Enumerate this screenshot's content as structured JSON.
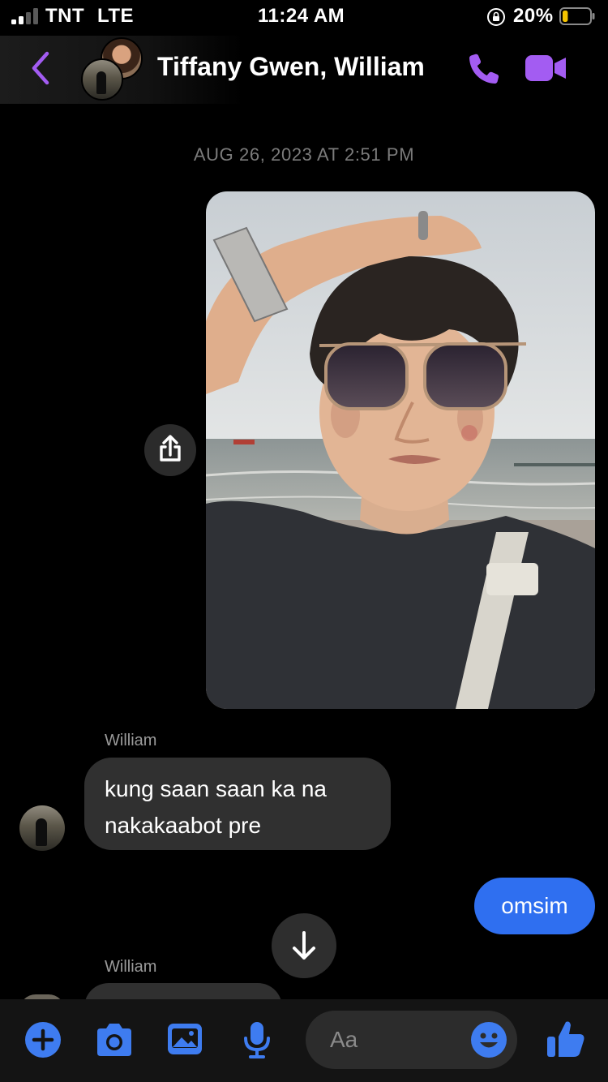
{
  "status_bar": {
    "carrier": "TNT",
    "network": "LTE",
    "time": "11:24 AM",
    "battery_percent": "20%",
    "battery_level": 0.2,
    "signal_bars": 2
  },
  "header": {
    "title": "Tiffany Gwen, William",
    "icons": [
      "back-chevron-icon",
      "phone-icon",
      "video-camera-icon"
    ],
    "accent_color": "#a35cf2"
  },
  "thread": {
    "timestamp": "AUG 26, 2023 AT 2:51 PM",
    "messages": [
      {
        "type": "photo",
        "from": "me",
        "icon": "share-icon"
      },
      {
        "type": "text",
        "from": "William",
        "sender_label": "William",
        "lines": [
          "kung saan saan ka na",
          "nakakaabot pre"
        ]
      },
      {
        "type": "text",
        "from": "me",
        "text": "omsim",
        "color": "#2f6ff0"
      },
      {
        "type": "text",
        "from": "William",
        "sender_label": "William",
        "partial": true
      }
    ]
  },
  "composer": {
    "placeholder": "Aa",
    "icons": [
      "plus-icon",
      "camera-icon",
      "gallery-icon",
      "microphone-icon",
      "emoji-icon",
      "thumbs-up-icon"
    ],
    "icon_color": "#3e7cf0"
  }
}
